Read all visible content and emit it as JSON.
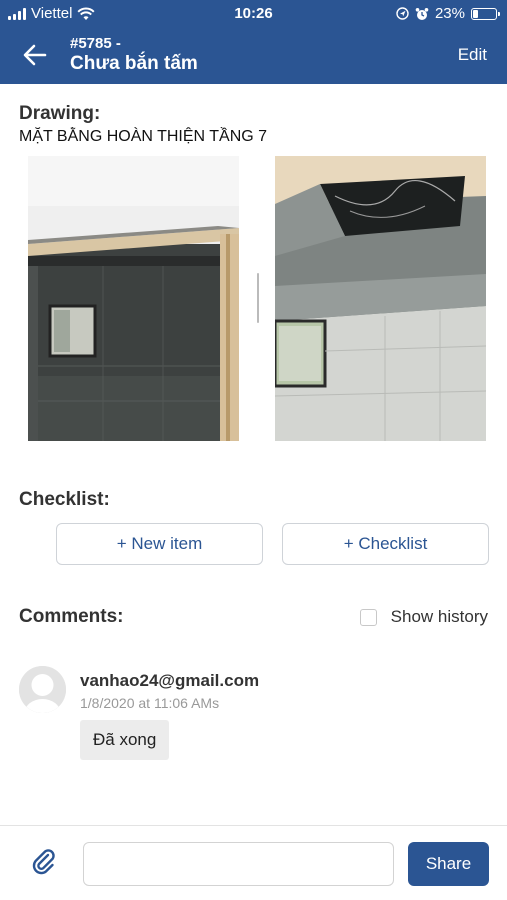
{
  "status_bar": {
    "carrier": "Viettel",
    "time": "10:26",
    "battery": "23%",
    "battery_level": 0.23,
    "icons": [
      "signal-icon",
      "wifi-icon",
      "location-icon",
      "alarm-icon",
      "battery-icon"
    ]
  },
  "header": {
    "back_icon": "arrow-left-icon",
    "task_id": "#5785 -",
    "title": "Chưa bắn tấm",
    "edit_label": "Edit"
  },
  "drawing": {
    "label": "Drawing:",
    "name": "MẶT BẰNG HOÀN THIỆN TẦNG 7",
    "photos": [
      "site-photo-wall-opening",
      "site-photo-ceiling-hatch"
    ]
  },
  "checklist": {
    "label": "Checklist:",
    "new_item_label": "+ New item",
    "add_checklist_label": "+ Checklist"
  },
  "comments": {
    "label": "Comments:",
    "show_history_label": "Show history",
    "show_history_checked": false,
    "items": [
      {
        "author": "vanhao24@gmail.com",
        "time": "1/8/2020 at 11:06 AMs",
        "text": "Đã xong"
      }
    ]
  },
  "composer": {
    "attach_icon": "paperclip-icon",
    "input_value": "",
    "input_placeholder": "",
    "share_label": "Share"
  },
  "colors": {
    "primary": "#2b5593",
    "link": "#2b5593",
    "bubble": "#ececec"
  }
}
